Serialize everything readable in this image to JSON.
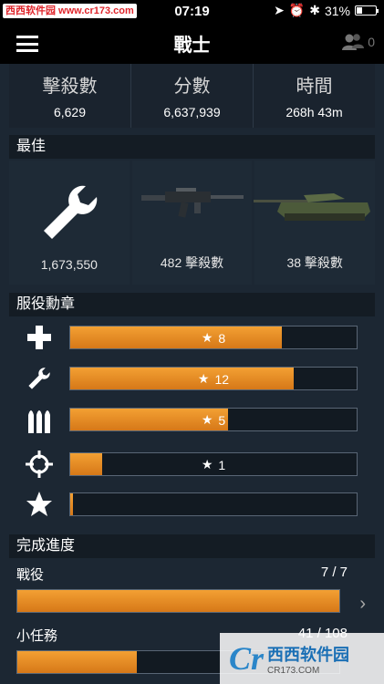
{
  "status_bar": {
    "watermark": "西西软件园 www.cr173.com",
    "time": "07:19",
    "battery": "31%"
  },
  "nav": {
    "title": "戰士",
    "friends_count": "0"
  },
  "stats": [
    {
      "label": "擊殺數",
      "value": "6,629"
    },
    {
      "label": "分數",
      "value": "6,637,939"
    },
    {
      "label": "時間",
      "value": "268h 43m"
    }
  ],
  "best": {
    "header": "最佳",
    "items": [
      {
        "icon": "wrench-icon",
        "caption": "1,673,550"
      },
      {
        "icon": "rifle-icon",
        "caption": "482 擊殺數"
      },
      {
        "icon": "tank-icon",
        "caption": "38 擊殺數"
      }
    ]
  },
  "medals": {
    "header": "服役勳章",
    "items": [
      {
        "icon": "medic-cross-icon",
        "progress": 0.74,
        "count": "8"
      },
      {
        "icon": "wrench-icon",
        "progress": 0.78,
        "count": "12"
      },
      {
        "icon": "ammo-icon",
        "progress": 0.55,
        "count": "5"
      },
      {
        "icon": "crosshair-icon",
        "progress": 0.11,
        "count": "1"
      },
      {
        "icon": "star-icon",
        "progress": 0.01,
        "count": ""
      }
    ]
  },
  "completion": {
    "header": "完成進度",
    "items": [
      {
        "label": "戰役",
        "value": "7 / 7",
        "progress": 1.0
      },
      {
        "label": "小任務",
        "value": "41 / 108",
        "progress": 0.37
      }
    ]
  },
  "logo_watermark": {
    "letter": "Cr",
    "name": "西西软件园",
    "url": "CR173.COM"
  },
  "colors": {
    "accent": "#e68a22",
    "background": "#1c2733"
  }
}
